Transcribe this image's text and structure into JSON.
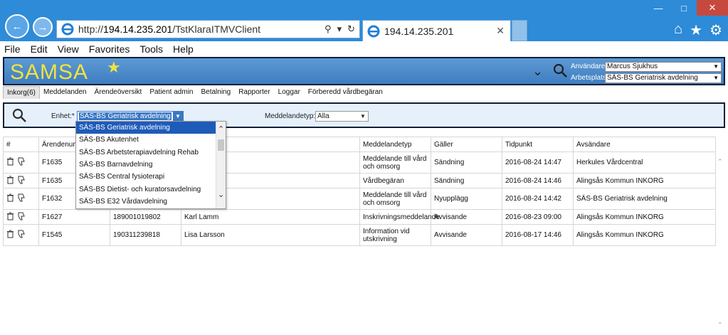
{
  "browser": {
    "url_prefix": "http://",
    "url_host": "194.14.235.201",
    "url_path": "/TstKlaraITMVClient",
    "tab_title": "194.14.235.201",
    "tab_close": "✕",
    "menu": [
      "File",
      "Edit",
      "View",
      "Favorites",
      "Tools",
      "Help"
    ]
  },
  "app": {
    "logo": "SAMSA",
    "user_label": "Användare:",
    "user_value": "Marcus Sjukhus",
    "place_label": "Arbetsplats:",
    "place_value": "SÄS-BS Geriatrisk avdelning",
    "nav": [
      "Inkorg(6)",
      "Meddelanden",
      "Ärendeöversikt",
      "Patient admin",
      "Betalning",
      "Rapporter",
      "Loggar",
      "Förberedd vårdbegäran"
    ]
  },
  "filter": {
    "enhet_label": "Enhet:*",
    "enhet_value": "SÄS-BS Geriatrisk avdelning",
    "mtyp_label": "Meddelandetyp:",
    "mtyp_value": "Alla"
  },
  "dropdown": {
    "items": [
      "SÄS-BS Geriatrisk avdelning",
      "SÄS-BS Akutenhet",
      "SÄS-BS Arbetsterapiavdelning Rehab",
      "SÄS-BS Barnavdelning",
      "SÄS-BS Central fysioterapi",
      "SÄS-BS Dietist- och kuratorsavdelning",
      "SÄS-BS E32 Vårdavdelning"
    ]
  },
  "table": {
    "headers": [
      "#",
      "Ärendenum",
      "",
      "",
      "Meddelandetyp",
      "Gäller",
      "Tidpunkt",
      "Avsändare"
    ],
    "rows": [
      {
        "arende": "F1635",
        "pnr": "",
        "namn": "",
        "mtyp": "Meddelande till vård och omsorg",
        "galler": "Sändning",
        "tid": "2016-08-24 14:47",
        "avs": "Herkules Vårdcentral"
      },
      {
        "arende": "F1635",
        "pnr": "",
        "namn": "",
        "mtyp": "Vårdbegäran",
        "galler": "Sändning",
        "tid": "2016-08-24 14:46",
        "avs": "Alingsås Kommun INKORG"
      },
      {
        "arende": "F1632",
        "pnr": "",
        "namn": "",
        "mtyp": "Meddelande till vård och omsorg",
        "galler": "Nyupplägg",
        "tid": "2016-08-24 14:42",
        "avs": "SÄS-BS Geriatrisk avdelning"
      },
      {
        "arende": "F1627",
        "pnr": "189001019802",
        "namn": "Karl Lamm",
        "mtyp": "Inskrivningsmeddelande",
        "galler": "Avvisande",
        "tid": "2016-08-23 09:00",
        "avs": "Alingsås Kommun INKORG"
      },
      {
        "arende": "F1545",
        "pnr": "190311239818",
        "namn": "Lisa Larsson",
        "mtyp": "Information vid utskrivning",
        "galler": "Avvisande",
        "tid": "2016-08-17 14:46",
        "avs": "Alingsås Kommun INKORG"
      }
    ]
  },
  "colors": {
    "chrome": "#2d8bd8",
    "logo": "#f2e33c",
    "selection": "#1e5bb8"
  }
}
